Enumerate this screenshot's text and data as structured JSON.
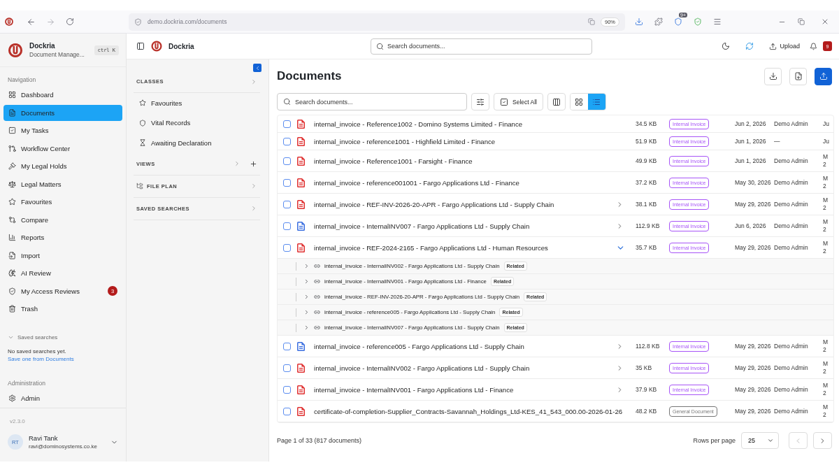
{
  "browser": {
    "url": "demo.dockria.com/documents",
    "zoom": "90%",
    "extension_badge": "9+"
  },
  "sidebar": {
    "app_name": "Dockria",
    "app_subtitle": "Document Manage...",
    "shortcut": "ctrl K",
    "nav_label": "Navigation",
    "items": [
      {
        "label": "Dashboard",
        "selected": false
      },
      {
        "label": "Documents",
        "selected": true
      },
      {
        "label": "My Tasks",
        "selected": false
      },
      {
        "label": "Workflow Center",
        "selected": false
      },
      {
        "label": "My Legal Holds",
        "selected": false
      },
      {
        "label": "Legal Matters",
        "selected": false
      },
      {
        "label": "Favourites",
        "selected": false
      },
      {
        "label": "Compare",
        "selected": false
      },
      {
        "label": "Reports",
        "selected": false
      },
      {
        "label": "Import",
        "selected": false
      },
      {
        "label": "AI Review",
        "selected": false
      },
      {
        "label": "My Access Reviews",
        "selected": false,
        "badge": "3"
      },
      {
        "label": "Trash",
        "selected": false
      }
    ],
    "saved_searches": {
      "label": "Saved searches",
      "empty_text": "No saved searches yet.",
      "link": "Save one from Documents"
    },
    "admin_label": "Administration",
    "admin_items": [
      {
        "label": "Admin",
        "selected": false
      }
    ],
    "version": "v2.3.0",
    "user": {
      "initials": "RT",
      "name": "Ravi Tank",
      "email": "ravi@dominosystems.co.ke"
    }
  },
  "panel": {
    "sections": [
      {
        "title": "CLASSES",
        "add_button": false,
        "items": [
          "Favourites",
          "Vital Records",
          "Awaiting Declaration"
        ]
      },
      {
        "title": "VIEWS",
        "add_button": true
      },
      {
        "title": "FILE PLAN",
        "add_button": false
      },
      {
        "title": "SAVED SEARCHES",
        "add_button": false
      }
    ]
  },
  "topbar": {
    "app_name": "Dockria",
    "search_placeholder": "Search documents...",
    "upload_label": "Upload",
    "notification_count": "9"
  },
  "main": {
    "title": "Documents",
    "search_placeholder": "Search documents...",
    "select_all": "Select All",
    "view_modes": [
      {
        "kind": "grid",
        "selected": false
      },
      {
        "kind": "list",
        "selected": true
      }
    ],
    "rows": [
      {
        "checked": false,
        "color": "#e03131",
        "name": "internal_invoice - Reference1002 - Domino Systems Limited - Finance",
        "expandable": false,
        "size": "34.5 KB",
        "tag": {
          "label": "Internal Invoice",
          "color": "#a855f7"
        },
        "date": "Jun 2, 2026",
        "owner": "Demo Admin",
        "cut": [
          "Ju"
        ]
      },
      {
        "checked": false,
        "color": "#e03131",
        "name": "internal_invoice - reference1001 - Highfield Limited - Finance",
        "expandable": false,
        "size": "51.9 KB",
        "tag": {
          "label": "Internal Invoice",
          "color": "#a855f7"
        },
        "date": "Jun 1, 2026",
        "owner": "—",
        "cut": [
          "Ju"
        ]
      },
      {
        "checked": false,
        "color": "#e03131",
        "name": "internal_invoice - Reference1001 - Farsight - Finance",
        "expandable": false,
        "size": "49.9 KB",
        "tag": {
          "label": "Internal Invoice",
          "color": "#a855f7"
        },
        "date": "Jun 1, 2026",
        "owner": "Demo Admin",
        "cut": [
          "M",
          "2"
        ]
      },
      {
        "checked": false,
        "color": "#e03131",
        "name": "internal_invoice - reference001001 - Fargo Applications Ltd - Finance",
        "expandable": false,
        "size": "37.2 KB",
        "tag": {
          "label": "Internal Invoice",
          "color": "#a855f7"
        },
        "date": "May 30, 2026",
        "owner": "Demo Admin",
        "cut": [
          "M",
          "2"
        ]
      },
      {
        "checked": false,
        "color": "#e03131",
        "name": "internal_invoice - REF-INV-2026-20-APR - Fargo Applications Ltd - Supply Chain",
        "expandable": true,
        "expanded": false,
        "size": "38.1 KB",
        "tag": {
          "label": "Internal Invoice",
          "color": "#a855f7"
        },
        "date": "May 29, 2026",
        "owner": "Demo Admin",
        "cut": [
          "M",
          "2"
        ]
      },
      {
        "checked": false,
        "color": "#3b6fe0",
        "name": "internal_invoice - InternalINV007 - Fargo Applications Ltd - Supply Chain",
        "expandable": true,
        "expanded": false,
        "size": "112.9 KB",
        "tag": {
          "label": "Internal Invoice",
          "color": "#a855f7"
        },
        "date": "Jun 6, 2026",
        "owner": "Demo Admin",
        "cut": [
          "M",
          "2"
        ]
      },
      {
        "checked": false,
        "color": "#e03131",
        "name": "internal_invoice - REF-2024-2165 - Fargo Applications Ltd - Human Resources",
        "expandable": true,
        "expanded": true,
        "size": "35.7 KB",
        "tag": {
          "label": "Internal Invoice",
          "color": "#a855f7"
        },
        "date": "May 29, 2026",
        "owner": "Demo Admin",
        "cut": [
          "M",
          "2"
        ],
        "children": [
          {
            "name": "internal_invoice - InternalINV002 - Fargo Applications Ltd - Supply Chain",
            "badge": "Related"
          },
          {
            "name": "internal_invoice - InternalINV001 - Fargo Applications Ltd - Finance",
            "badge": "Related"
          },
          {
            "name": "internal_invoice - REF-INV-2026-20-APR - Fargo Applications Ltd - Supply Chain",
            "badge": "Related"
          },
          {
            "name": "internal_invoice - reference005 - Fargo Applications Ltd - Supply Chain",
            "badge": "Related"
          },
          {
            "name": "internal_invoice - InternalINV007 - Fargo Applications Ltd - Supply Chain",
            "badge": "Related"
          }
        ]
      },
      {
        "checked": false,
        "color": "#3b6fe0",
        "name": "internal_invoice - reference005 - Fargo Applications Ltd - Supply Chain",
        "expandable": true,
        "expanded": false,
        "size": "112.8 KB",
        "tag": {
          "label": "Internal Invoice",
          "color": "#a855f7"
        },
        "date": "May 29, 2026",
        "owner": "Demo Admin",
        "cut": [
          "M",
          "2"
        ]
      },
      {
        "checked": false,
        "color": "#e03131",
        "name": "internal_invoice - InternalINV002 - Fargo Applications Ltd - Supply Chain",
        "expandable": true,
        "expanded": false,
        "size": "35 KB",
        "tag": {
          "label": "Internal Invoice",
          "color": "#a855f7"
        },
        "date": "May 29, 2026",
        "owner": "Demo Admin",
        "cut": [
          "M",
          "2"
        ]
      },
      {
        "checked": false,
        "color": "#e03131",
        "name": "internal_invoice - InternalINV001 - Fargo Applications Ltd - Finance",
        "expandable": true,
        "expanded": false,
        "size": "37.9 KB",
        "tag": {
          "label": "Internal Invoice",
          "color": "#a855f7"
        },
        "date": "May 29, 2026",
        "owner": "Demo Admin",
        "cut": [
          "M",
          "2"
        ]
      },
      {
        "checked": false,
        "color": "#e03131",
        "name": "certificate-of-completion-Supplier_Contracts-Savannah_Holdings_Ltd-KES_41_543_000.00-2026-01-26",
        "expandable": false,
        "size": "48.2 KB",
        "tag": {
          "label": "General Document",
          "color": "#777777"
        },
        "date": "May 29, 2026",
        "owner": "Demo Admin",
        "cut": [
          "M",
          "2"
        ]
      }
    ],
    "footer": {
      "page_info": "Page 1 of 33 (817 documents)",
      "rows_per_page_label": "Rows per page",
      "rows_per_page": "25"
    }
  }
}
